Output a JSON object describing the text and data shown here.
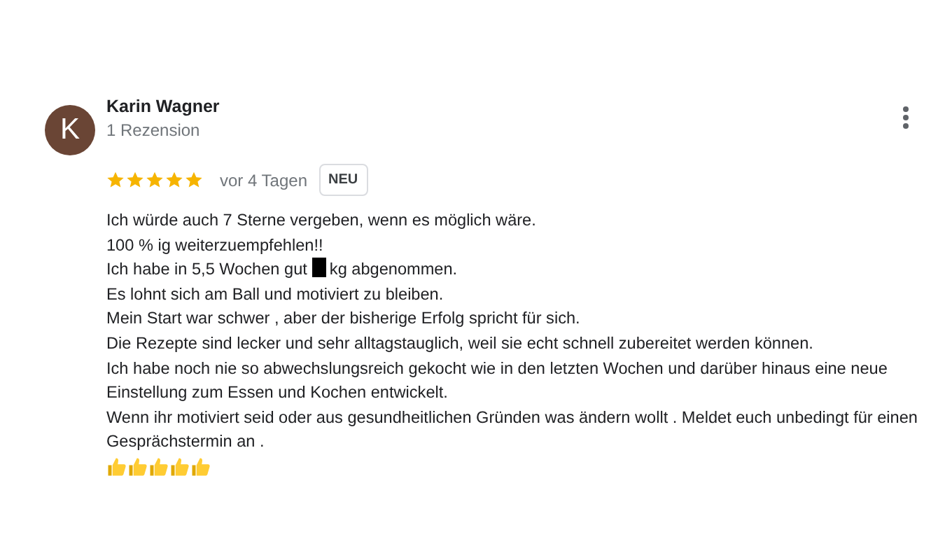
{
  "review": {
    "avatar_initial": "K",
    "author": "Karin Wagner",
    "review_count": "1 Rezension",
    "stars": 5,
    "date": "vor 4 Tagen",
    "badge": "NEU",
    "lines": [
      {
        "kind": "text",
        "text": "Ich würde auch 7 Sterne vergeben, wenn es möglich wäre."
      },
      {
        "kind": "text",
        "text": "100 % ig weiterzuempfehlen!!"
      },
      {
        "kind": "redacted",
        "before": "Ich habe in 5,5 Wochen gut",
        "after": "kg abgenommen."
      },
      {
        "kind": "text",
        "text": "Es lohnt sich am Ball und motiviert zu bleiben."
      },
      {
        "kind": "text",
        "text": "Mein Start war schwer , aber der bisherige Erfolg spricht für sich."
      },
      {
        "kind": "text",
        "text": "Die Rezepte sind lecker und sehr alltagstauglich, weil sie echt schnell zubereitet werden können."
      },
      {
        "kind": "text",
        "text": "Ich habe noch nie so abwechslungsreich gekocht wie in den letzten Wochen und darüber hinaus eine neue Einstellung zum Essen und Kochen entwickelt."
      },
      {
        "kind": "text",
        "text": "Wenn ihr motiviert seid oder aus gesundheitlichen Gründen was ändern wollt . Meldet euch unbedingt für einen Gesprächstermin an ."
      }
    ],
    "emojis": [
      {
        "kind": "thumbs-up"
      },
      {
        "kind": "thumbs-up"
      },
      {
        "kind": "thumbs-up"
      },
      {
        "kind": "thumbs-up"
      },
      {
        "kind": "thumbs-up"
      }
    ]
  }
}
